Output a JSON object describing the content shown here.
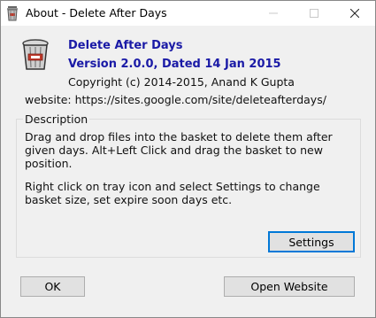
{
  "window": {
    "title": "About - Delete After Days",
    "icon": "basket-icon"
  },
  "about": {
    "app_name": "Delete After Days",
    "version": "Version 2.0.0, Dated 14 Jan 2015",
    "copyright": "Copyright (c) 2014-2015, Anand K Gupta",
    "website": "website: https://sites.google.com/site/deleteafterdays/"
  },
  "description": {
    "label": "Description",
    "paragraph1": "Drag and drop files into the basket to delete them after given days. Alt+Left Click and drag the basket to new position.",
    "paragraph2": "Right click on tray icon and select Settings to change basket size, set expire soon days etc."
  },
  "buttons": {
    "settings": "Settings",
    "ok": "OK",
    "open_website": "Open Website"
  },
  "colors": {
    "accent": "#1a1aa6",
    "focus_border": "#0078d7",
    "window_bg": "#f0f0f0"
  }
}
